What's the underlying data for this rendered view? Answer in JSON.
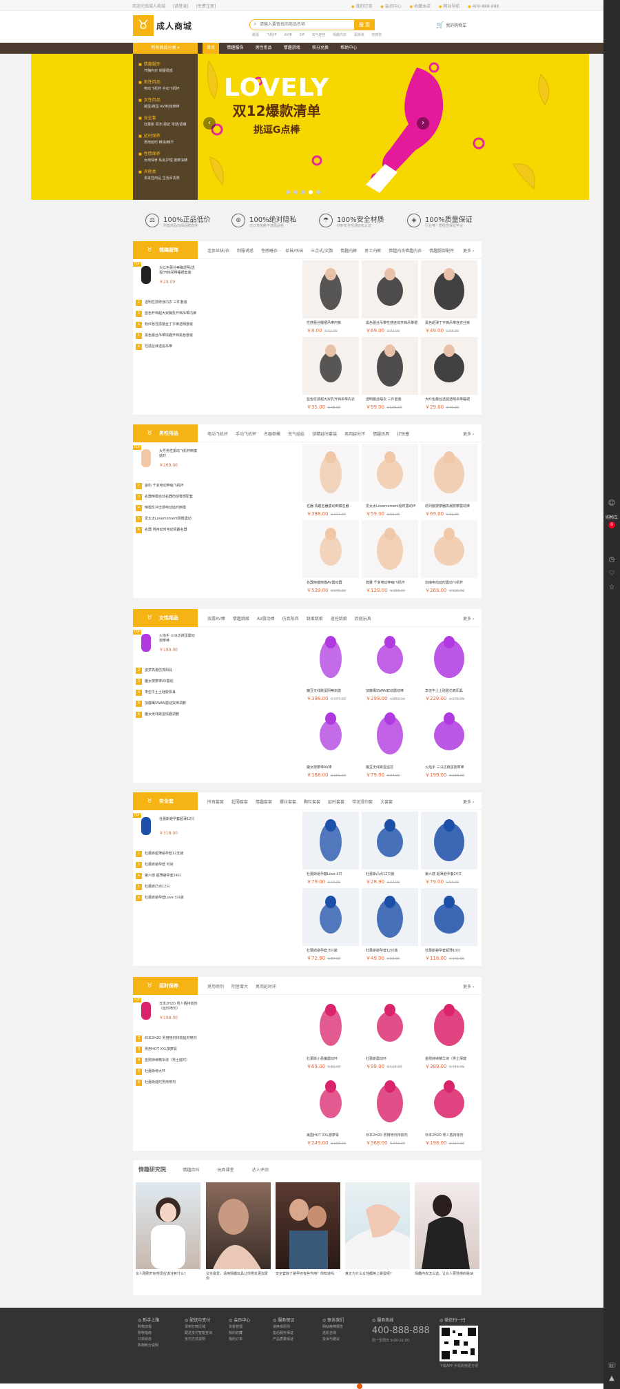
{
  "topbar": {
    "left": [
      "欢迎光临城人商城",
      "[请登录]",
      "[免费注册]"
    ],
    "right": [
      "我的订单",
      "会员中心",
      "收藏本店",
      "网站导航",
      "400-888-888"
    ]
  },
  "header": {
    "logo_text": "成人商城",
    "logo_mark": "♉",
    "search_placeholder": "请输入要查找的商品名称",
    "search_button": "搜 索",
    "hot_words": [
      "跳蛋",
      "飞机杯",
      "AV棒",
      "SM",
      "充气娃娃",
      "情趣内衣",
      "润滑液",
      "伤感伤"
    ],
    "cart_label": "我的购物车"
  },
  "nav": {
    "category_btn": "所有商品分类 ▾",
    "items": [
      "首页",
      "情趣服饰",
      "男性用品",
      "情趣游戏",
      "积分兑换",
      "帮助中心"
    ],
    "active": 0
  },
  "side_menu": [
    {
      "title": "情趣服饰",
      "sub": "开胸内衣  制服诱惑"
    },
    {
      "title": "男性用品",
      "sub": "电动飞机杯  手动飞机杯"
    },
    {
      "title": "女性用品",
      "sub": "跳蛋/跳蛋  AV棒/按摩棒"
    },
    {
      "title": "安全套",
      "sub": "杜蕾斯  冈本/香妃  零感/紧绷"
    },
    {
      "title": "延时保养",
      "sub": "男用延时  精油/精华"
    },
    {
      "title": "性情保养",
      "sub": "女用保养  私处护理  按摩油精"
    },
    {
      "title": "其他类",
      "sub": "未来性用品  生活百货类"
    }
  ],
  "banner": {
    "title": "LOVELY",
    "line2": "双12爆款清单",
    "line3": "挑逗G点棒",
    "prev": "‹",
    "next": "›",
    "dots": 5,
    "active_dot": 3
  },
  "services": [
    {
      "icon": "⚖",
      "title": "100%正品低价",
      "sub": "所售商品均由品牌直供"
    },
    {
      "icon": "⊛",
      "title": "100%绝对隐私",
      "sub": "无订单包裹不透露品名"
    },
    {
      "icon": "☂",
      "title": "100%安全材质",
      "sub": "材料安全检测达标认证"
    },
    {
      "icon": "◈",
      "title": "100%质量保证",
      "sub": "行业唯一质检性保证平台"
    }
  ],
  "floors": [
    {
      "name": "情趣服饰",
      "tabs": [
        "连体丝袜/衣",
        "制服诱惑",
        "性感睡衣",
        "丝袜/吊袜",
        "三点式/文胸",
        "情趣内裤",
        "男士内裤",
        "情趣内衣情趣内衣",
        "情趣腿部配件"
      ],
      "more": "更多 ›",
      "top": {
        "badge": "TOP",
        "name": "大红色蕾丝美胸透明/透视/开档吊带睡裙套装",
        "price": "￥29.00"
      },
      "rank": [
        "透明性感修身内衣 三件套装",
        "蓝色开档超大双胸乳开档吊带内裤",
        "粉红色性感蕾丝丁字裤透明套装",
        "黑色蕾丝吊带情趣开档黑色套装",
        "性感丝袜透视吊带"
      ],
      "products": [
        {
          "name": "性感蕾丝睡裙吊带内裤",
          "price": "￥8.00",
          "orig": "￥12.00"
        },
        {
          "name": "黑色蕾丝吊带性感连体开档吊带裙",
          "price": "￥69.00",
          "orig": "￥92.00"
        },
        {
          "name": "黑色超薄丁字裤吊带连衣丝袜",
          "price": "￥49.00",
          "orig": "￥68.00"
        },
        {
          "name": "蓝色性感超大双乳开档吊带内衣",
          "price": "￥35.00",
          "orig": "￥48.00"
        },
        {
          "name": "透明蕾丝睡衣 三件套装",
          "price": "￥99.00",
          "orig": "￥136.00"
        },
        {
          "name": "大红色蕾丝透视透明吊带睡裙",
          "price": "￥29.00",
          "orig": "￥40.00"
        }
      ]
    },
    {
      "name": "男性用品",
      "tabs": [
        "电动飞机杯",
        "手动飞机杯",
        "名器倒模",
        "充气娃娃",
        "锁精延时套装",
        "男用延时环",
        "情趣玩具",
        "拉珠塞"
      ],
      "more": "更多 ›",
      "top": {
        "badge": "TOP",
        "name": "大号男性振动飞机杯倒模延时",
        "price": "￥269.00"
      },
      "rank": [
        "姿豹 千变电动伸缩飞机杯",
        "名器倒模自动名器肉感臀部配套",
        "倒模反冲击感电动延时倒模",
        "爱太太Lovemoment阴臀震动",
        "名器 男用延时电动情趣名器"
      ],
      "products": [
        {
          "name": "名器 情趣名器震动倒模名器",
          "price": "￥398.00",
          "orig": "￥477.00"
        },
        {
          "name": "爱太太Lovemoment延时震动环",
          "price": "￥59.00",
          "orig": "￥69.00"
        },
        {
          "name": "前列腺按摩器高潮按摩震动棒",
          "price": "￥69.00",
          "orig": "￥92.00"
        },
        {
          "name": "名器倒模倒模AV震动器",
          "price": "￥539.00",
          "orig": "￥645.00"
        },
        {
          "name": "典雅 千变电动伸缩飞机杯",
          "price": "￥129.00",
          "orig": "￥159.00"
        },
        {
          "name": "剑魂电动延时震动飞机杯",
          "price": "￥269.00",
          "orig": "￥320.00"
        }
      ]
    },
    {
      "name": "女性用品",
      "tabs": [
        "双震AV棒",
        "情趣跳蛋",
        "AV震动棒",
        "仿真阳具",
        "跳蛋跳蛋",
        "遥控跳蛋",
        "后庭玩具"
      ],
      "more": "更多 ›",
      "top": {
        "badge": "TOP",
        "name": "火焰手 三马达跳蛋震动按摩棒",
        "price": "￥199.00"
      },
      "rank": [
        "姿梦高潮仿真阳具",
        "魔女按摩棒AV震动",
        "李伍牛土土硅胶阳具",
        "加藤鹰SWAN震动双棒调教",
        "魔女无线跳蛋情趣调教"
      ],
      "products": [
        {
          "name": "魔豆无线跳蛋阴蒂刺激",
          "price": "￥398.00",
          "orig": "￥477.00"
        },
        {
          "name": "加藤鹰SWAN双动震动棒",
          "price": "￥299.00",
          "orig": "￥359.00"
        },
        {
          "name": "李伍牛土土硅胶仿真阳具",
          "price": "￥229.00",
          "orig": "￥275.00"
        },
        {
          "name": "魔女按摩棒AV棒",
          "price": "￥168.00",
          "orig": "￥201.00"
        },
        {
          "name": "魔豆无线跳蛋遥控",
          "price": "￥79.00",
          "orig": "￥94.00"
        },
        {
          "name": "火焰手 三马达跳蛋按摩棒",
          "price": "￥199.00",
          "orig": "￥238.00"
        }
      ]
    },
    {
      "name": "安全套",
      "tabs": [
        "所有套套",
        "超薄套套",
        "情趣套套",
        "螺纹套套",
        "颗粒套套",
        "延时套套",
        "带润滑剂套",
        "大套套"
      ],
      "more": "更多 ›",
      "top": {
        "badge": "TOP",
        "name": "杜蕾斯避孕套超薄12只",
        "price": "￥318.00"
      },
      "rank": [
        "杜蕾斯超薄避孕套12支装",
        "杜蕾斯避孕套 时尚",
        "第六感 超薄避孕套24只",
        "杜蕾斯凸点12只",
        "杜蕾斯避孕套Love 3只装"
      ],
      "products": [
        {
          "name": "杜蕾斯避孕套Love 3只",
          "price": "￥79.00",
          "orig": "￥94.00"
        },
        {
          "name": "杜蕾斯凸点12只装",
          "price": "￥28.90",
          "orig": "￥34.00"
        },
        {
          "name": "第六感 超薄避孕套24只",
          "price": "￥79.00",
          "orig": "￥94.00"
        },
        {
          "name": "杜蕾斯避孕套 8只装",
          "price": "￥72.90",
          "orig": "￥87.00"
        },
        {
          "name": "杜蕾斯避孕套12只装",
          "price": "￥49.00",
          "orig": "￥58.00"
        },
        {
          "name": "杜蕾斯避孕套超薄10只",
          "price": "￥118.00",
          "orig": "￥141.00"
        }
      ]
    },
    {
      "name": "延时保养",
      "tabs": [
        "男用喷剂",
        "阴茎增大",
        "男用延时环"
      ],
      "more": "更多 ›",
      "top": {
        "badge": "TOP",
        "name": "日本2H2D 男人香持效剂（延时喷剂）",
        "price": "￥198.00"
      },
      "rank": [
        "日本2H2D 男用喷剂持效延时喷剂",
        "男用HOT XXL按摩膏",
        "金刚持续精华液（男士延时）",
        "杜蕾斯增大环",
        "杜蕾斯延时男用喷剂"
      ],
      "products": [
        {
          "name": "杜蕾斯小恶魔震动环",
          "price": "￥69.00",
          "orig": "￥82.00"
        },
        {
          "name": "杜蕾斯震动环",
          "price": "￥99.00",
          "orig": "￥118.00"
        },
        {
          "name": "金刚持续精华液（男士保健",
          "price": "￥389.00",
          "orig": "￥466.00"
        },
        {
          "name": "美国HOT XXL按摩膏",
          "price": "￥249.00",
          "orig": "￥298.00"
        },
        {
          "name": "日本2H2D 男用喷剂持效剂",
          "price": "￥368.00",
          "orig": "￥440.00"
        },
        {
          "name": "日本2H2D 男人香持效剂",
          "price": "￥198.00",
          "orig": "￥237.00"
        }
      ]
    }
  ],
  "research": {
    "title": "情趣研究院",
    "tabs": [
      "情趣百科",
      "玩具课堂",
      "达人评测"
    ],
    "cards": [
      "女人刚刚开始性爱应该注意什么？",
      "女生最爱，请用情趣玩具让你男友更加爱你",
      "安全套除了避孕还有些作用？你知道吗",
      "真正为什么女性都用上跳蛋呢？",
      "情趣内衣怎么选，让女人更性感的秘诀"
    ]
  },
  "footer": {
    "cols": [
      {
        "title": "新手上路",
        "items": [
          "购物流程",
          "购物指南",
          "订单状态",
          "购物积分说明"
        ]
      },
      {
        "title": "配送与支付",
        "items": [
          "货到付款区域",
          "配送支付智能查询",
          "支付方式说明"
        ]
      },
      {
        "title": "会员中心",
        "items": [
          "资金管理",
          "我的收藏",
          "我的订单"
        ]
      },
      {
        "title": "服务保证",
        "items": [
          "退换货原则",
          "售后服务保证",
          "产品质量保证"
        ]
      },
      {
        "title": "联系我们",
        "items": [
          "网站故障报告",
          "选机咨询",
          "投诉与建议"
        ]
      }
    ],
    "phone_label": "服务热线",
    "phone": "400-888-888",
    "hours": "周一至周日 9:00-21:00",
    "qr_label": "微信扫一扫",
    "qr_cap": "下载APP 手机购物更方便"
  },
  "sidebar_cart": {
    "label": "购物车",
    "count": "0"
  },
  "colors": {
    "accent": "#f6b414",
    "nav": "#4b3a2f",
    "price": "#e63",
    "banner": "#f6d800"
  }
}
